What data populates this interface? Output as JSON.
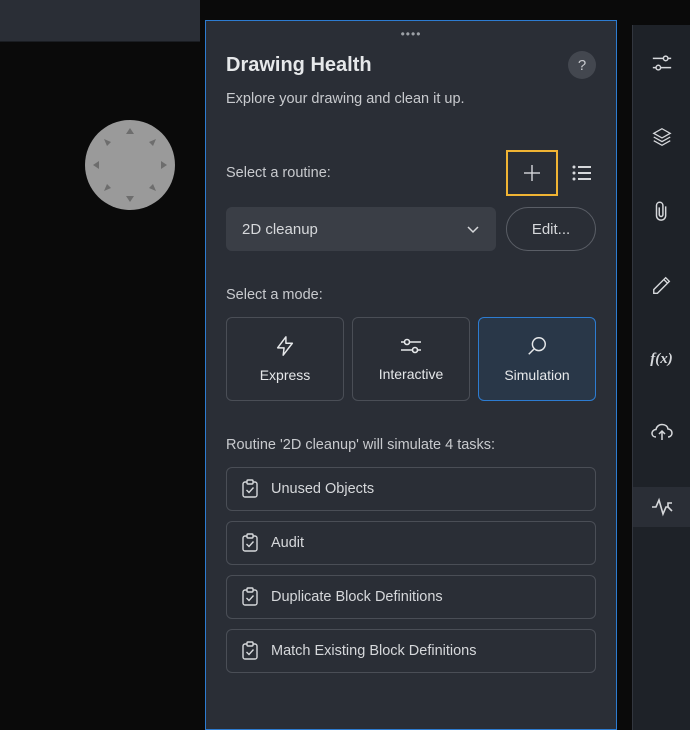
{
  "panel": {
    "title": "Drawing Health",
    "subtitle": "Explore your drawing and clean it up.",
    "help": "?",
    "routine_label": "Select a routine:",
    "selected_routine": "2D cleanup",
    "edit_label": "Edit...",
    "mode_label": "Select a mode:",
    "modes": [
      {
        "label": "Express",
        "active": false
      },
      {
        "label": "Interactive",
        "active": false
      },
      {
        "label": "Simulation",
        "active": true
      }
    ],
    "tasks_header": "Routine '2D cleanup' will simulate 4 tasks:",
    "tasks": [
      {
        "label": "Unused Objects"
      },
      {
        "label": "Audit"
      },
      {
        "label": "Duplicate Block Definitions"
      },
      {
        "label": "Match Existing Block Definitions"
      }
    ]
  },
  "rail": {
    "items": [
      {
        "name": "settings"
      },
      {
        "name": "layers"
      },
      {
        "name": "attachment"
      },
      {
        "name": "annotate"
      },
      {
        "name": "fx"
      },
      {
        "name": "cloud-upload"
      },
      {
        "name": "health"
      }
    ],
    "active_index": 6
  },
  "colors": {
    "accent": "#2d7cd1",
    "highlight": "#f0b434",
    "panel_bg": "#2a2e36",
    "canvas_bg": "#0a0a0a"
  }
}
